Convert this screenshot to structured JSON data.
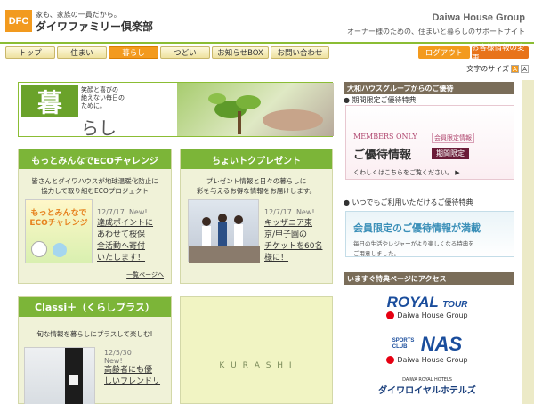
{
  "header": {
    "logo_badge": "DFC",
    "tagline_small": "家も、家族の一員だから。",
    "club_name": "ダイワファミリー倶楽部",
    "brand": "Daiwa House Group",
    "site_tagline": "オーナー様のための、住まいと暮らしのサポートサイト"
  },
  "nav": {
    "items": [
      {
        "label": "トップ"
      },
      {
        "label": "住まい"
      },
      {
        "label": "暮らし"
      },
      {
        "label": "つどい"
      },
      {
        "label": "お知らせBOX"
      },
      {
        "label": "お問い合わせ"
      }
    ],
    "login": "ログアウト",
    "customer_info": "お客様情報の変更",
    "font_size_label": "文字のサイズ",
    "font_small": "A",
    "font_large": "A"
  },
  "hero": {
    "kanji": "暮",
    "rest": "らし",
    "copy_line1": "笑顔と喜びの",
    "copy_line2": "絶えない毎日の",
    "copy_line3": "ために。"
  },
  "eco_card": {
    "title": "もっとみんなでECOチャレンジ",
    "sub_line1": "皆さんとダイワハウスが地球温暖化防止に",
    "sub_line2": "協力して取り組むECOプロジェクト",
    "img_text": "もっとみんなでECOチャレンジ",
    "date": "12/7/17",
    "new": "New!",
    "link_line1": "達成ポイントに",
    "link_line2": "あわせて桜保",
    "link_line3": "全活動へ寄付",
    "link_line4": "いたします！",
    "more": "一覧ページへ"
  },
  "present_card": {
    "title": "ちょいトクプレゼント",
    "sub_line1": "プレゼント情報と日々の暮らしに",
    "sub_line2": "彩を与えるお得な情報をお届けします。",
    "date": "12/7/17",
    "new": "New!",
    "link_line1": "キッザニア東",
    "link_line2": "京/甲子園の",
    "link_line3": "チケットを60名",
    "link_line4": "様に！"
  },
  "classi_card": {
    "title": "Classi＋（くらしプラス）",
    "sub": "旬な情報を暮らしにプラスして楽しむ!",
    "date": "12/5/30",
    "new": "New!",
    "link_line1": "高齢者にも優",
    "link_line2": "しいフレンドリ"
  },
  "kurashi_card": {
    "text": "K U R A S H I"
  },
  "sidebar": {
    "benefits_title": "大和ハウスグループからのご優待",
    "limited_label": "期間限定ご優待特典",
    "members_only": "MEMBERS ONLY",
    "members_info": "会員限定情報",
    "yutai": "ご優待情報",
    "period": "期間限定",
    "details": "くわしくはこちらをご覧ください。",
    "always_label": "いつでもご利用いただけるご優待特典",
    "box2_title": "会員限定のご優待情報が満載",
    "box2_sub1": "毎日の生活やレジャーがより楽しくなる特典を",
    "box2_sub2": "ご用意しました。",
    "access_title": "いますぐ特典ページにアクセス",
    "royal": "ROYAL",
    "royal_tour": "TOUR",
    "daiwa_house_group": "Daiwa House Group",
    "sports_club": "SPORTS CLUB",
    "nas": "NAS",
    "daiwa_royal_hotels": "DAIWA ROYAL HOTELS",
    "hotels_jp": "ダイワロイヤルホテルズ"
  },
  "colors": {
    "green": "#7cb538",
    "orange": "#f39a1e",
    "sidebar_bar": "#7a6d59",
    "navy": "#1a4d9c"
  }
}
